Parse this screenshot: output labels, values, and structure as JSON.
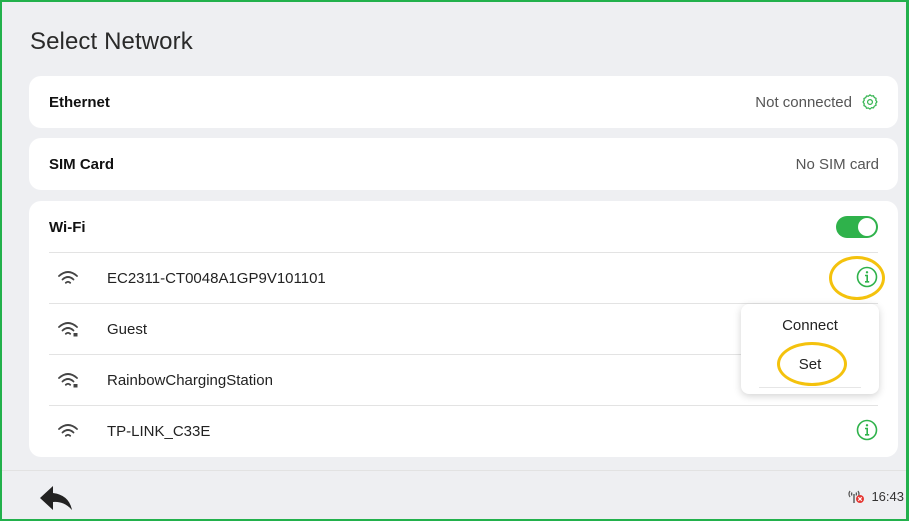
{
  "page": {
    "title": "Select Network"
  },
  "ethernet": {
    "label": "Ethernet",
    "status": "Not connected",
    "settings_icon": "gear-icon"
  },
  "sim": {
    "label": "SIM Card",
    "status": "No SIM card"
  },
  "wifi": {
    "label": "Wi-Fi",
    "enabled": true,
    "networks": [
      {
        "name": "EC2311-CT0048A1GP9V101101",
        "secured": false,
        "info_icon": true,
        "highlighted": true
      },
      {
        "name": "Guest",
        "secured": true,
        "info_icon": false
      },
      {
        "name": "RainbowChargingStation",
        "secured": true,
        "info_icon": false
      },
      {
        "name": "TP-LINK_C33E",
        "secured": false,
        "info_icon": true
      }
    ]
  },
  "popup_menu": {
    "items": [
      {
        "label": "Connect"
      },
      {
        "label": "Set",
        "highlighted": true
      }
    ]
  },
  "status_bar": {
    "time": "16:43",
    "signal_icon": "no-signal-icon",
    "back_icon": "back-arrow-icon"
  },
  "colors": {
    "accent": "#2fb24b",
    "highlight": "#f4c20d",
    "frame": "#22b14c"
  }
}
